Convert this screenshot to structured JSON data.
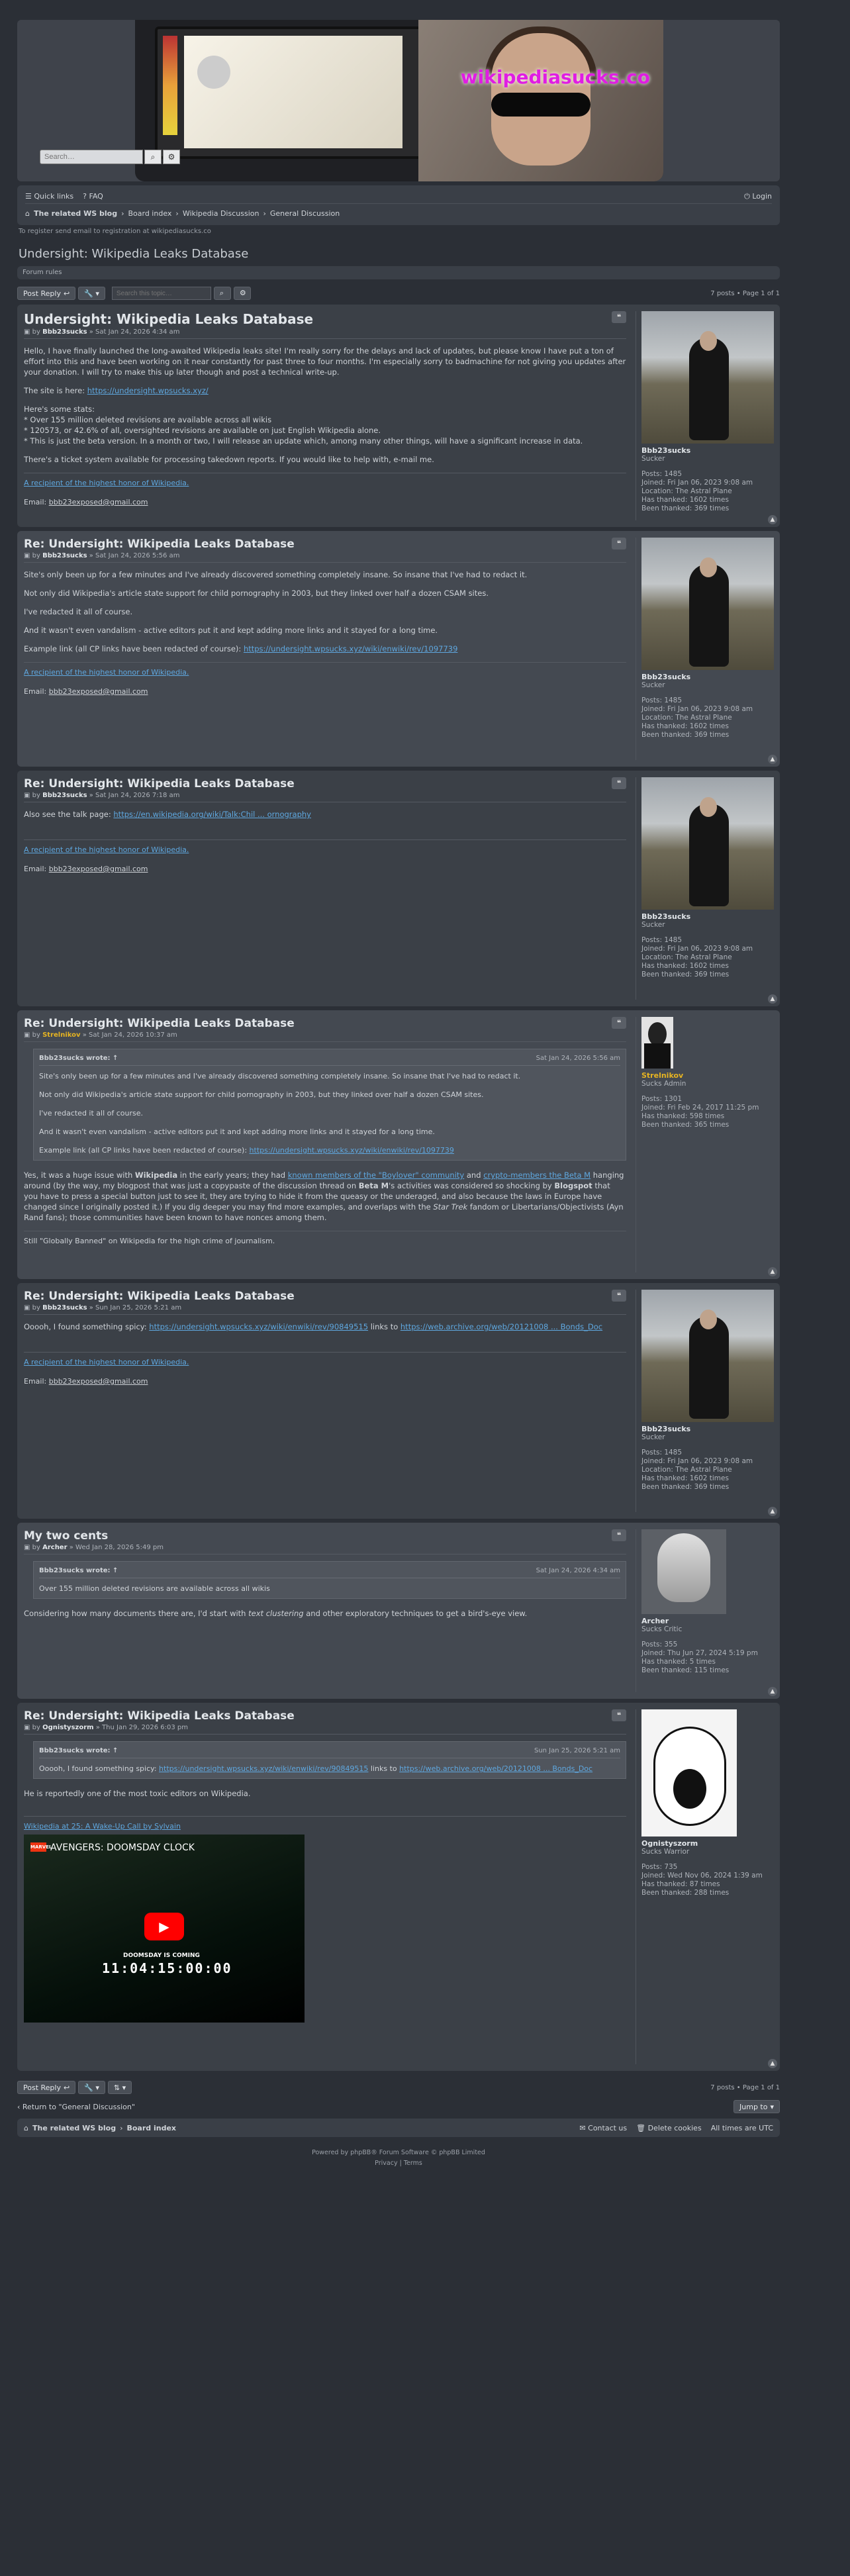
{
  "header": {
    "brand": "wikipediasucks.co",
    "search_placeholder": "Search…"
  },
  "nav": {
    "quick_links": "Quick links",
    "faq": "FAQ",
    "login": "Login",
    "crumbs": [
      "The related WS blog",
      "Board index",
      "Wikipedia Discussion",
      "General Discussion"
    ]
  },
  "register_note": "To register send email to registration at wikipediasucks.co",
  "topic_title": "Undersight: Wikipedia Leaks Database",
  "forum_rules": "Forum rules",
  "action_bar": {
    "post_reply": "Post Reply",
    "search_placeholder": "Search this topic…",
    "pagination": "7 posts • Page 1 of 1"
  },
  "posts": [
    {
      "title": "Undersight: Wikipedia Leaks Database",
      "by": "by",
      "author": "Bbb23sucks",
      "date": "» Sat Jan 24, 2026 4:34 am",
      "p1": "Hello, I have finally launched the long-awaited Wikipedia leaks site! I'm really sorry for the delays and lack of updates, but please know I have put a ton of effort into this and have been working on it near constantly for past three to four months. I'm especially sorry to badmachine for not giving you updates after your donation. I will try to make this up later though and post a technical write-up.",
      "p2_prefix": "The site is here: ",
      "p2_link": "https://undersight.wpsucks.xyz/",
      "stats_head": "Here's some stats:",
      "stat1": "* Over 155 million deleted revisions are available across all wikis",
      "stat2": "* 120573, or 42.6% of all, oversighted revisions are available on just English Wikipedia alone.",
      "stat3": "* This is just the beta version. In a month or two, I will release an update which, among many other things, will have a significant increase in data.",
      "p4": "There's a ticket system available for processing takedown reports. If you would like to help with, e-mail me.",
      "sig1": "A recipient of the highest honor of Wikipedia.",
      "sig_email_label": "Email: ",
      "sig_email": "bbb23exposed@gmail.com"
    },
    {
      "title": "Re: Undersight: Wikipedia Leaks Database",
      "author": "Bbb23sucks",
      "date": "» Sat Jan 24, 2026 5:56 am",
      "p1": "Site's only been up for a few minutes and I've already discovered something completely insane. So insane that I've had to redact it.",
      "p2": "Not only did Wikipedia's article state support for child pornography in 2003, but they linked over half a dozen CSAM sites.",
      "p3": "I've redacted it all of course.",
      "p4": "And it wasn't even vandalism - active editors put it and kept adding more links and it stayed for a long time.",
      "p5_prefix": "Example link (all CP links have been redacted of course): ",
      "p5_link": "https://undersight.wpsucks.xyz/wiki/enwiki/rev/1097739"
    },
    {
      "title": "Re: Undersight: Wikipedia Leaks Database",
      "author": "Bbb23sucks",
      "date": "» Sat Jan 24, 2026 7:18 am",
      "p1_prefix": "Also see the talk page: ",
      "p1_link": "https://en.wikipedia.org/wiki/Talk:Chil ... ornography"
    },
    {
      "title": "Re: Undersight: Wikipedia Leaks Database",
      "author": "Strelnikov",
      "date": "» Sat Jan 24, 2026 10:37 am",
      "quote_author": "Bbb23sucks wrote: ↑",
      "quote_date": "Sat Jan 24, 2026 5:56 am",
      "q5_link": "https://undersight.wpsucks.xyz/wiki/enwiki/rev/1097739",
      "p1a": "Yes, it was a huge issue with ",
      "p1b": "Wikipedia",
      "p1c": " in the early years; they had ",
      "p1link1": "known members of the \"Boylover\" community",
      "p1d": " and ",
      "p1link2": "crypto-members the Beta M",
      "p1e": " hanging around (by the way, my blogpost that was just a copypaste of the discussion thread on ",
      "p1f": "Beta M",
      "p1g": "'s activities was considered so shocking by ",
      "p1h": "Blogspot",
      "p1i": " that you have to press a special button just to see it, they are trying to hide it from the queasy or the underaged, and also because the laws in Europe have changed since I originally posted it.) If you dig deeper you may find more examples, and overlaps with the ",
      "p1j": "Star Trek",
      "p1k": " fandom or Libertarians/Objectivists (Ayn Rand fans); those communities have been known to have nonces among them.",
      "sig": "Still \"Globally Banned\" on Wikipedia for the high crime of journalism."
    },
    {
      "title": "Re: Undersight: Wikipedia Leaks Database",
      "author": "Bbb23sucks",
      "date": "» Sun Jan 25, 2026 5:21 am",
      "p1a": "Ooooh, I found something spicy: ",
      "p1link1": "https://undersight.wpsucks.xyz/wiki/enwiki/rev/90849515",
      "p1b": " links to ",
      "p1link2": "https://web.archive.org/web/20121008 ... Bonds_Doc"
    },
    {
      "title": "My two cents",
      "author": "Archer",
      "date": "» Wed Jan 28, 2026 5:49 pm",
      "quote_author": "Bbb23sucks wrote: ↑",
      "quote_date": "Sat Jan 24, 2026 4:34 am",
      "q1": "Over 155 million deleted revisions are available across all wikis",
      "p1a": "Considering how many documents there are, I'd start with ",
      "p1b": "text clustering",
      "p1c": " and other exploratory techniques to get a bird's-eye view."
    },
    {
      "title": "Re: Undersight: Wikipedia Leaks Database",
      "author": "Ognistyszorm",
      "date": "» Thu Jan 29, 2026 6:03 pm",
      "quote_author": "Bbb23sucks wrote: ↑",
      "quote_date": "Sun Jan 25, 2026 5:21 am",
      "q1a": "Ooooh, I found something spicy: ",
      "q1link1": "https://undersight.wpsucks.xyz/wiki/enwiki/rev/90849515",
      "q1b": " links to ",
      "q1link2": "https://web.archive.org/web/20121008 ... Bonds_Doc",
      "p1": "He is reportedly one of the most toxic editors on Wikipedia.",
      "sig": "Wikipedia at 25: A Wake-Up Call by Sylvain",
      "video_title": "AVENGERS: DOOMSDAY CLOCK",
      "video_coming": "DOOMSDAY IS COMING",
      "video_clock": "11:04:15:00:00"
    }
  ],
  "profiles": {
    "bbb": {
      "name": "Bbb23sucks",
      "rank": "Sucker",
      "posts": "Posts: 1485",
      "joined": "Joined: Fri Jan 06, 2023 9:08 am",
      "location": "Location: The Astral Plane",
      "thanked": "Has thanked: 1602 times",
      "been": "Been thanked: 369 times"
    },
    "strel": {
      "name": "Strelnikov",
      "rank": "Sucks Admin",
      "posts": "Posts: 1301",
      "joined": "Joined: Fri Feb 24, 2017 11:25 pm",
      "thanked": "Has thanked: 598 times",
      "been": "Been thanked: 365 times"
    },
    "archer": {
      "name": "Archer",
      "rank": "Sucks Critic",
      "posts": "Posts: 355",
      "joined": "Joined: Thu Jun 27, 2024 5:19 pm",
      "thanked": "Has thanked: 5 times",
      "been": "Been thanked: 115 times"
    },
    "ogn": {
      "name": "Ognistyszorm",
      "rank": "Sucks Warrior",
      "posts": "Posts: 735",
      "joined": "Joined: Wed Nov 06, 2024 1:39 am",
      "thanked": "Has thanked: 87 times",
      "been": "Been thanked: 288 times"
    }
  },
  "bottom": {
    "return": "Return to \"General Discussion\"",
    "jump": "Jump to"
  },
  "footer": {
    "crumb1": "The related WS blog",
    "crumb2": "Board index",
    "contact": "Contact us",
    "cookies": "Delete cookies",
    "tz": "All times are UTC",
    "powered": "Powered by phpBB® Forum Software © phpBB Limited",
    "privacy": "Privacy",
    "terms": "Terms"
  }
}
